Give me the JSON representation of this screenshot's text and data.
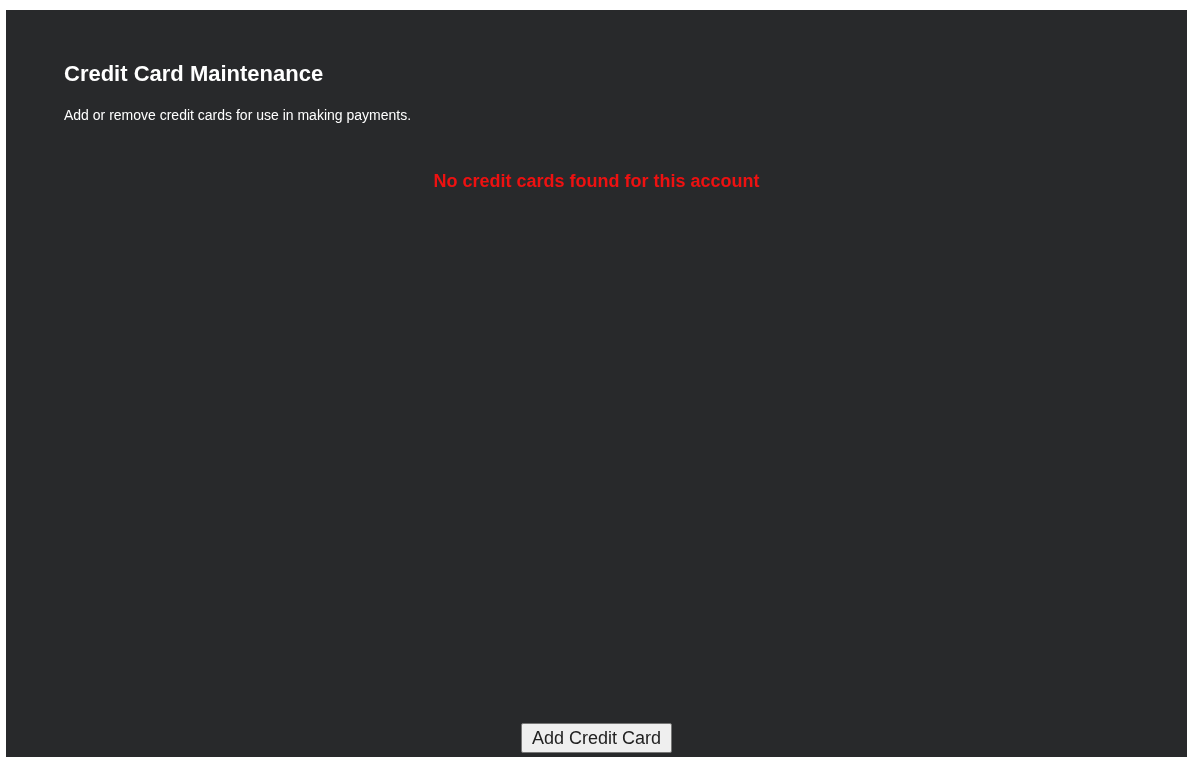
{
  "title": "Credit Card Maintenance",
  "description": "Add or remove credit cards for use in making payments.",
  "message": "No credit cards found for this account",
  "buttons": [
    "Add Credit Card"
  ]
}
